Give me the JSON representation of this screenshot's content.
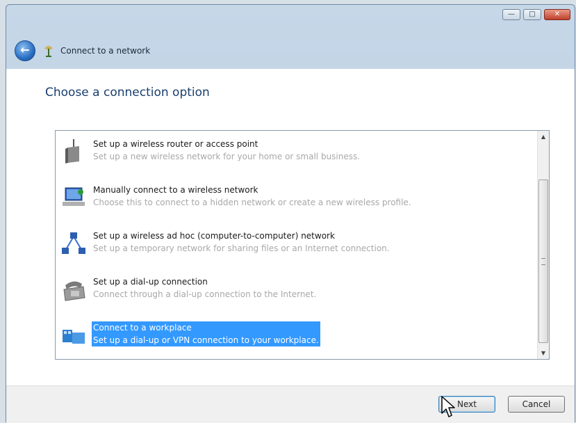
{
  "window": {
    "title": "Connect to a network",
    "caption_buttons": [
      "minimize",
      "maximize",
      "close"
    ]
  },
  "nav": {
    "back_icon": "back-arrow-icon",
    "network_icon": "network-icon"
  },
  "main": {
    "heading": "Choose a connection option",
    "options": [
      {
        "title": "Set up a wireless router or access point",
        "description": "Set up a new wireless network for your home or small business.",
        "icon": "wireless-router-icon"
      },
      {
        "title": "Manually connect to a wireless network",
        "description": "Choose this to connect to a hidden network or create a new wireless profile.",
        "icon": "wireless-network-icon"
      },
      {
        "title": "Set up a wireless ad hoc (computer-to-computer) network",
        "description": "Set up a temporary network for sharing files or an Internet connection.",
        "icon": "ad-hoc-network-icon"
      },
      {
        "title": "Set up a dial-up connection",
        "description": "Connect through a dial-up connection to the Internet.",
        "icon": "dial-up-phone-icon"
      },
      {
        "title": "Connect to a workplace",
        "description": "Set up a dial-up or VPN connection to your workplace.",
        "icon": "workplace-vpn-icon",
        "selected": true
      }
    ]
  },
  "footer": {
    "next_label": "Next",
    "cancel_label": "Cancel"
  },
  "colors": {
    "selection": "#3399ff",
    "heading": "#1a3e6e",
    "description": "#a8a8a8"
  }
}
